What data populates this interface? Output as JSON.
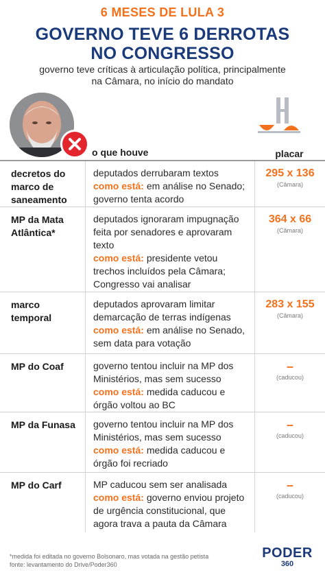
{
  "header": {
    "kicker": "6 MESES DE LULA 3",
    "title_line1": "GOVERNO TEVE 6 DERROTAS",
    "title_line2": "NO CONGRESSO",
    "subtitle_line1": "governo teve críticas à articulação política, principalmente",
    "subtitle_line2": "na Câmara, no início do mandato"
  },
  "columns": {
    "what": "o que houve",
    "score": "placar"
  },
  "status_label": "como está:",
  "rows": [
    {
      "name": [
        "decretos do",
        "marco de",
        "saneamento"
      ],
      "desc": [
        "deputados derrubaram textos"
      ],
      "status": [
        "em análise no Senado;",
        "governo tenta acordo"
      ],
      "score": "295 x 136",
      "score_note": "(Câmara)"
    },
    {
      "name": [
        "MP da Mata",
        "Atlântica*"
      ],
      "desc": [
        "deputados ignoraram impugnação",
        "feita por senadores e aprovaram",
        "texto"
      ],
      "status": [
        "presidente vetou",
        "trechos incluídos pela Câmara;",
        "Congresso vai analisar"
      ],
      "score": "364 x 66",
      "score_note": "(Câmara)"
    },
    {
      "name": [
        "marco",
        "temporal"
      ],
      "desc": [
        "deputados aprovaram limitar",
        "demarcação de terras indígenas"
      ],
      "status": [
        "em análise no Senado,",
        "sem data para votação"
      ],
      "score": "283 x 155",
      "score_note": "(Câmara)"
    },
    {
      "name": [
        "MP do Coaf"
      ],
      "desc": [
        "governo tentou incluir na MP dos",
        "Ministérios, mas sem sucesso"
      ],
      "status": [
        "medida caducou e",
        "órgão voltou ao BC"
      ],
      "score": "–",
      "score_note": "(caducou)"
    },
    {
      "name": [
        "MP da Funasa"
      ],
      "desc": [
        "governo tentou incluir na MP dos",
        "Ministérios, mas sem sucesso"
      ],
      "status": [
        "medida caducou e",
        "órgão foi recriado"
      ],
      "score": "–",
      "score_note": "(caducou)"
    },
    {
      "name": [
        "MP do Carf"
      ],
      "desc": [
        "MP caducou sem ser analisada"
      ],
      "status": [
        "governo enviou projeto",
        "de urgência constitucional, que",
        "agora trava a pauta da Câmara"
      ],
      "score": "–",
      "score_note": "(caducou)"
    }
  ],
  "footer": {
    "note": "*medida foi editada no governo Bolsonaro, mas votada na gestão petista",
    "source": "fonte: levantamento do Drive/Poder360",
    "logo": "PODER",
    "logo_sub": "360"
  },
  "colors": {
    "accent": "#f2711c",
    "navy": "#1a3a7a",
    "alert": "#e3262e"
  }
}
